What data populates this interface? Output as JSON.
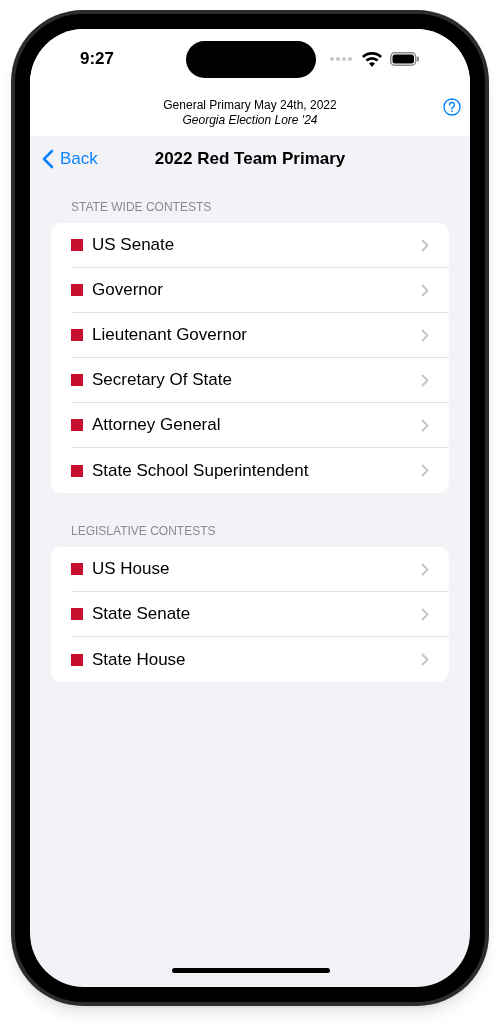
{
  "status_bar": {
    "time": "9:27"
  },
  "header": {
    "title": "General Primary May 24th, 2022",
    "subtitle": "Georgia Election Lore '24"
  },
  "nav": {
    "back": "Back",
    "title": "2022 Red Team Primary"
  },
  "sections": [
    {
      "title": "STATE WIDE CONTESTS",
      "items": [
        "US Senate",
        "Governor",
        "Lieutenant Governor",
        "Secretary Of State",
        "Attorney General",
        "State School Superintendent"
      ]
    },
    {
      "title": "LEGISLATIVE CONTESTS",
      "items": [
        "US House",
        "State Senate",
        "State House"
      ]
    }
  ]
}
